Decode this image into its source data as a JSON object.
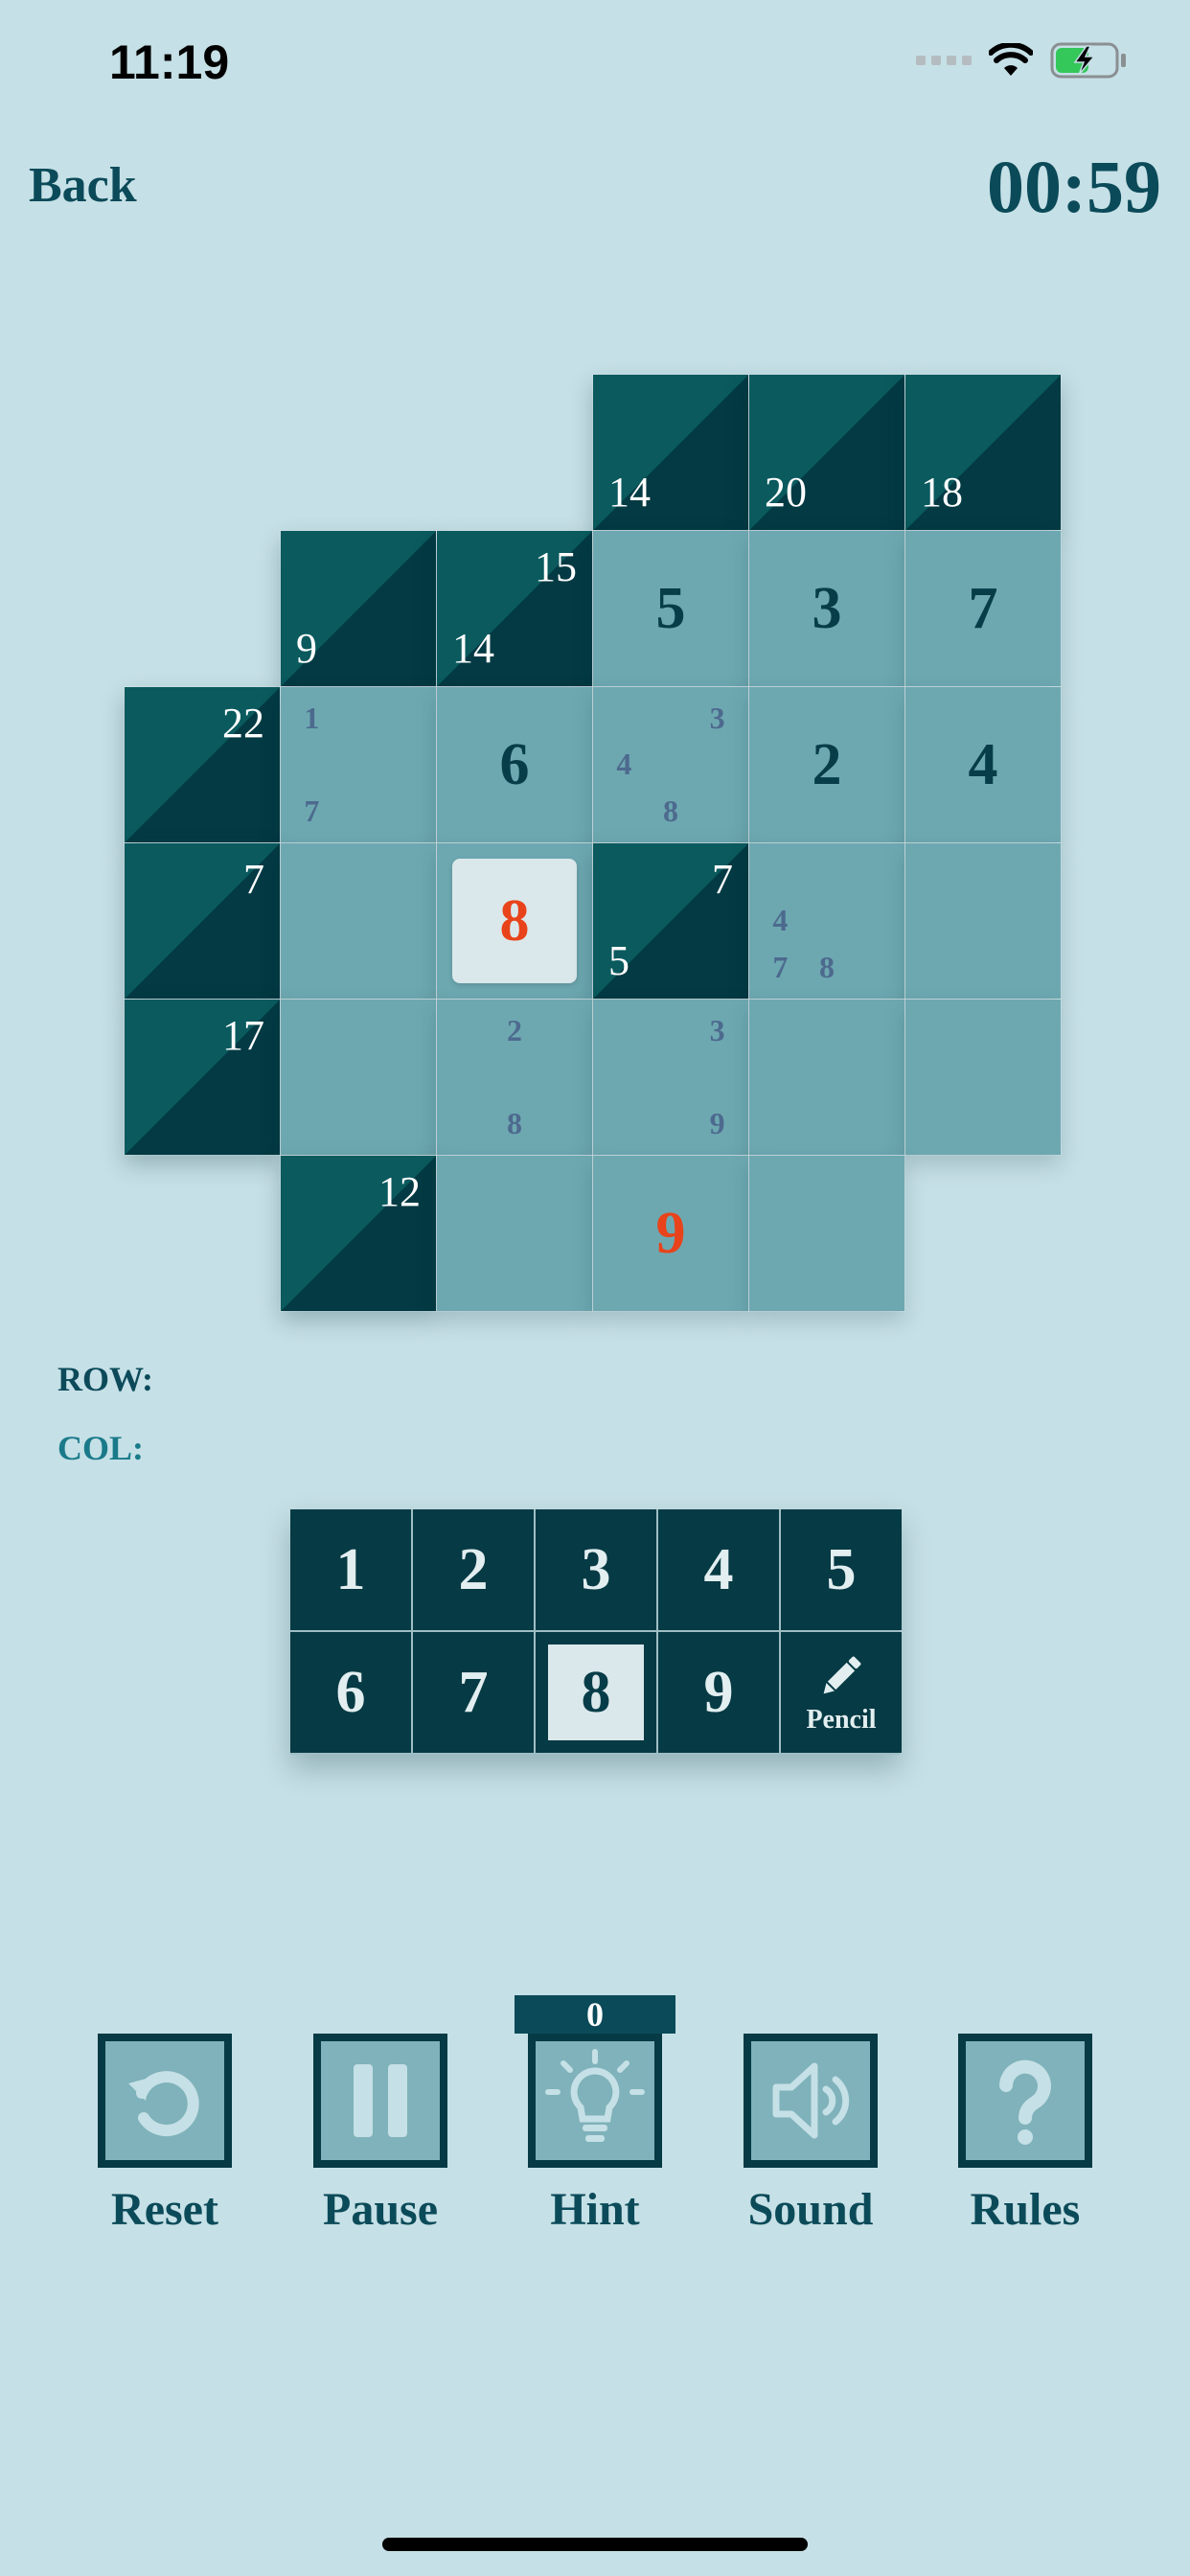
{
  "status_bar": {
    "time": "11:19"
  },
  "header": {
    "back_label": "Back",
    "timer": "00:59"
  },
  "board": {
    "cells": [
      {
        "row": 0,
        "col": 3,
        "type": "black",
        "down": "14"
      },
      {
        "row": 0,
        "col": 4,
        "type": "black",
        "down": "20"
      },
      {
        "row": 0,
        "col": 5,
        "type": "black",
        "down": "18"
      },
      {
        "row": 1,
        "col": 1,
        "type": "black",
        "down": "9"
      },
      {
        "row": 1,
        "col": 2,
        "type": "black",
        "right": "15",
        "down": "14"
      },
      {
        "row": 1,
        "col": 3,
        "type": "white",
        "value": "5"
      },
      {
        "row": 1,
        "col": 4,
        "type": "white",
        "value": "3"
      },
      {
        "row": 1,
        "col": 5,
        "type": "white",
        "value": "7"
      },
      {
        "row": 2,
        "col": 0,
        "type": "black",
        "right": "22"
      },
      {
        "row": 2,
        "col": 1,
        "type": "white",
        "notes": [
          "1",
          "",
          "",
          "",
          "",
          "",
          "7",
          "",
          ""
        ]
      },
      {
        "row": 2,
        "col": 2,
        "type": "white",
        "value": "6"
      },
      {
        "row": 2,
        "col": 3,
        "type": "white",
        "notes": [
          "",
          "",
          "3",
          "4",
          "",
          "",
          "",
          "8",
          ""
        ]
      },
      {
        "row": 2,
        "col": 4,
        "type": "white",
        "value": "2"
      },
      {
        "row": 2,
        "col": 5,
        "type": "white",
        "value": "4"
      },
      {
        "row": 3,
        "col": 0,
        "type": "black",
        "right": "7"
      },
      {
        "row": 3,
        "col": 1,
        "type": "white"
      },
      {
        "row": 3,
        "col": 2,
        "type": "white",
        "value": "8",
        "selected": true
      },
      {
        "row": 3,
        "col": 3,
        "type": "black",
        "right": "7",
        "down": "5"
      },
      {
        "row": 3,
        "col": 4,
        "type": "white",
        "notes": [
          "",
          "",
          "",
          "4",
          "",
          "",
          "7",
          "8",
          ""
        ]
      },
      {
        "row": 3,
        "col": 5,
        "type": "white"
      },
      {
        "row": 4,
        "col": 0,
        "type": "black",
        "right": "17"
      },
      {
        "row": 4,
        "col": 1,
        "type": "white"
      },
      {
        "row": 4,
        "col": 2,
        "type": "white",
        "notes": [
          "",
          "2",
          "",
          "",
          "",
          "",
          "",
          "8",
          ""
        ]
      },
      {
        "row": 4,
        "col": 3,
        "type": "white",
        "notes": [
          "",
          "",
          "3",
          "",
          "",
          "",
          "",
          "",
          "9"
        ]
      },
      {
        "row": 4,
        "col": 4,
        "type": "white"
      },
      {
        "row": 4,
        "col": 5,
        "type": "white"
      },
      {
        "row": 5,
        "col": 1,
        "type": "black",
        "right": "12"
      },
      {
        "row": 5,
        "col": 2,
        "type": "white"
      },
      {
        "row": 5,
        "col": 3,
        "type": "white",
        "value": "9",
        "red": true
      },
      {
        "row": 5,
        "col": 4,
        "type": "white"
      }
    ]
  },
  "info": {
    "row_label": "ROW:",
    "col_label": "COL:"
  },
  "numpad": {
    "keys": [
      "1",
      "2",
      "3",
      "4",
      "5",
      "6",
      "7",
      "8",
      "9"
    ],
    "selected": "8",
    "pencil_label": "Pencil"
  },
  "toolbar": {
    "hint_count": "0",
    "reset_label": "Reset",
    "pause_label": "Pause",
    "hint_label": "Hint",
    "sound_label": "Sound",
    "rules_label": "Rules",
    "icon_color": "#c5e0e6"
  }
}
